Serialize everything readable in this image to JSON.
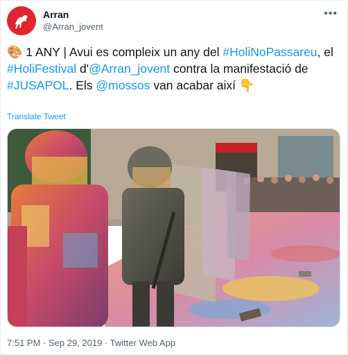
{
  "account": {
    "name": "Arran",
    "handle": "@Arran_jovent"
  },
  "tweet": {
    "emoji_lead": "🎨",
    "seg1": " 1 ANY | Avui es compleix un any del ",
    "hashtag1": "#HoliNoPassareu",
    "seg2": ", el ",
    "hashtag2": "#HoliFestival",
    "seg3": " d'",
    "mention1": "@Arran_jovent",
    "seg4": " contra la manifestació de ",
    "hashtag3": "#JUSAPOL",
    "seg5": ". Els ",
    "mention2": "@mossos",
    "seg6": " van acabar així ",
    "emoji_trail": "👇"
  },
  "translate_label": "Translate Tweet",
  "meta": "7:51 PM · Sep 29, 2019 · Twitter Web App",
  "colors": {
    "link": "#1b95e0",
    "avatar": "#e0262d"
  },
  "icons": {
    "more": "more-icon",
    "avatar": "arran-logo-icon"
  }
}
